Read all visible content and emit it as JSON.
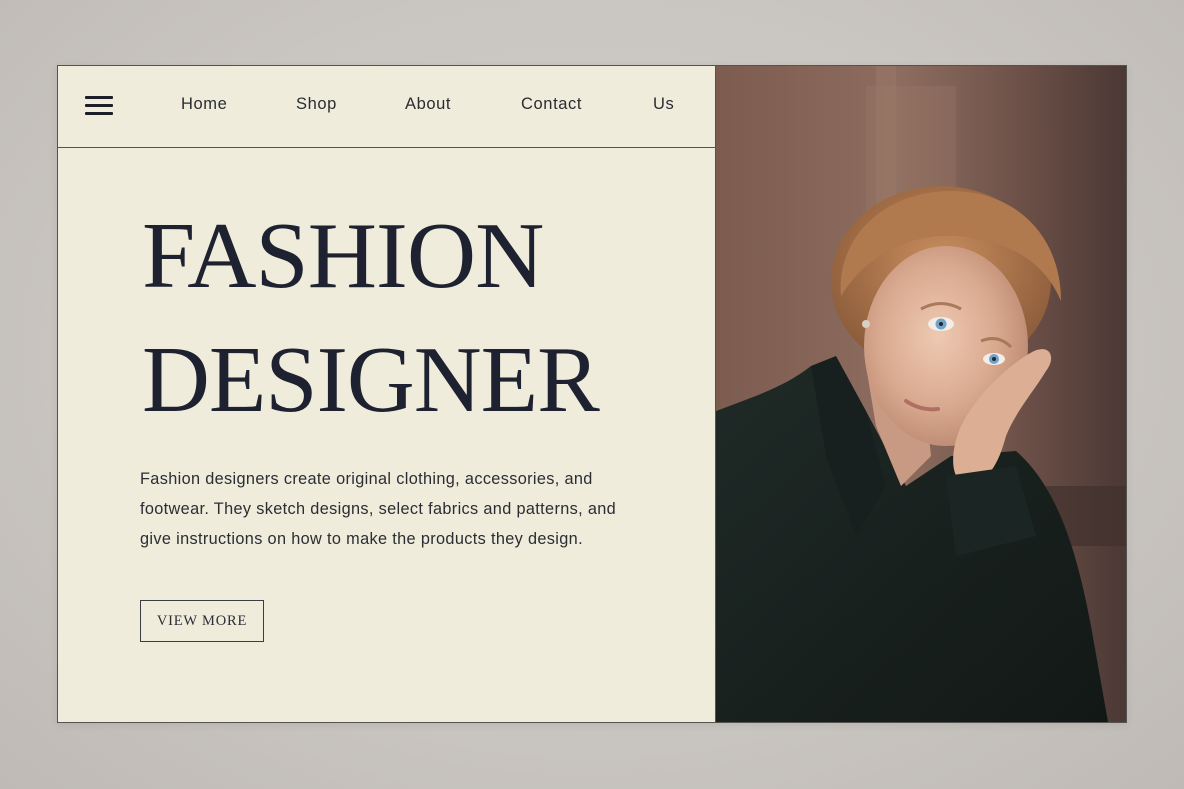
{
  "nav": {
    "menu_icon": "hamburger-menu-icon",
    "links": [
      "Home",
      "Shop",
      "About",
      "Contact",
      "Us"
    ]
  },
  "hero": {
    "headline_line1": "FASHION",
    "headline_line2": "DESIGNER",
    "description_lines": [
      "Fashion designers create original clothing, accessories, and",
      "footwear. They sketch designs, select fabrics and patterns, and",
      "give instructions on how to make the products they design."
    ],
    "button_label": "VIEW MORE"
  },
  "colors": {
    "panel_background": "#efecdc",
    "text_dark": "#1d2130",
    "border": "#55534f",
    "page_background": "#cdc9c4",
    "jacket": "#1a2421"
  }
}
